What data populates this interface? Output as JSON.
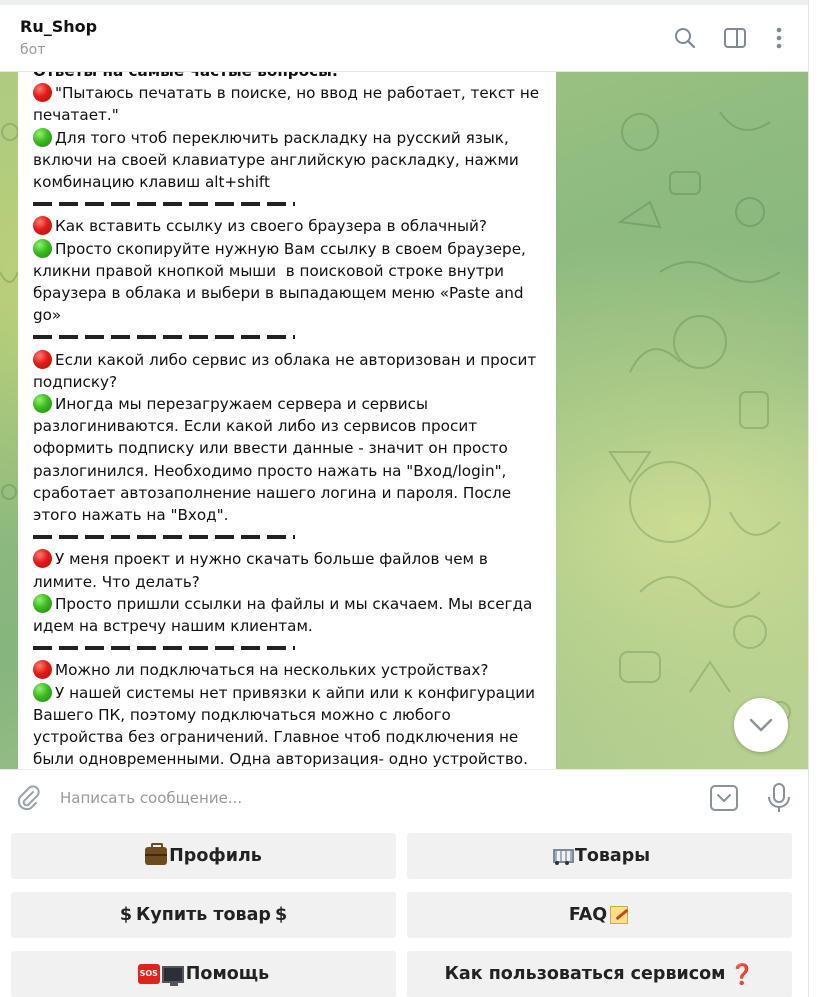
{
  "header": {
    "title": "Ru_Shop",
    "subtitle": "бот",
    "search_icon": "search-icon",
    "sidebar_icon": "sidebar-toggle-icon",
    "menu_icon": "more-vertical-icon"
  },
  "message": {
    "heading": "Ответы на самые частые вопросы:",
    "qa": [
      {
        "q": "\"Пытаюсь печатать в поиске, но ввод не работает, текст не печатает.\"",
        "a": "Для того чтоб переключить раскладку на русский язык, включи на своей клавиатуре английскую раскладку, нажми комбинацию клавиш alt+shift"
      },
      {
        "q": "Как вставить ссылку из своего браузера в облачный?",
        "a": "Просто скопируйте нужную Вам ссылку в своем браузере, кликни правой кнопкой мыши  в поисковой строке внутри браузера в облака и выбери в выпадающем меню «Paste and go»"
      },
      {
        "q": "Если какой либо сервис из облака не авторизован и просит подписку?",
        "a": "Иногда мы перезагружаем сервера и сервисы разлогиниваются. Если какой либо из сервисов просит оформить подписку или ввести данные - значит он просто разлогинился. Необходимо просто нажать на \"Вход/login\", сработает автозаполнение нашего логина и пароля. После этого нажать на \"Вход\"."
      },
      {
        "q": "У меня проект и нужно скачать больше файлов чем в лимите. Что делать?",
        "a": "Просто пришли ссылки на файлы и мы скачаем. Мы всегда идем на встречу нашим клиентам."
      },
      {
        "q": "Можно ли подключаться на нескольких устройствах?",
        "a": "У нашей системы нет привязки к айпи или к конфигурации Вашего ПК, поэтому подключаться можно с любого устройства без ограничений. Главное чтоб подключения не были одновременными. Одна авторизация- одно устройство. Два"
      }
    ],
    "red_marker": "red-circle-icon",
    "green_marker": "green-circle-icon"
  },
  "compose": {
    "placeholder": "Написать сообщение...",
    "attach_icon": "paperclip-icon",
    "keyboard_icon": "bot-keyboard-icon",
    "mic_icon": "microphone-icon"
  },
  "keyboard": {
    "profile": "Профиль",
    "goods": "Товары",
    "buy": "Купить товар",
    "faq": "FAQ",
    "help": "Помощь",
    "how_to_use": "Как пользоваться сервисом",
    "dollar": "$",
    "sos": "SOS",
    "question_mark": "❓"
  },
  "colors": {
    "chat_bg_green": "#8fbb7f",
    "red_marker": "#e21b16",
    "green_marker": "#3cba22",
    "button_bg": "#f1f1f1"
  }
}
